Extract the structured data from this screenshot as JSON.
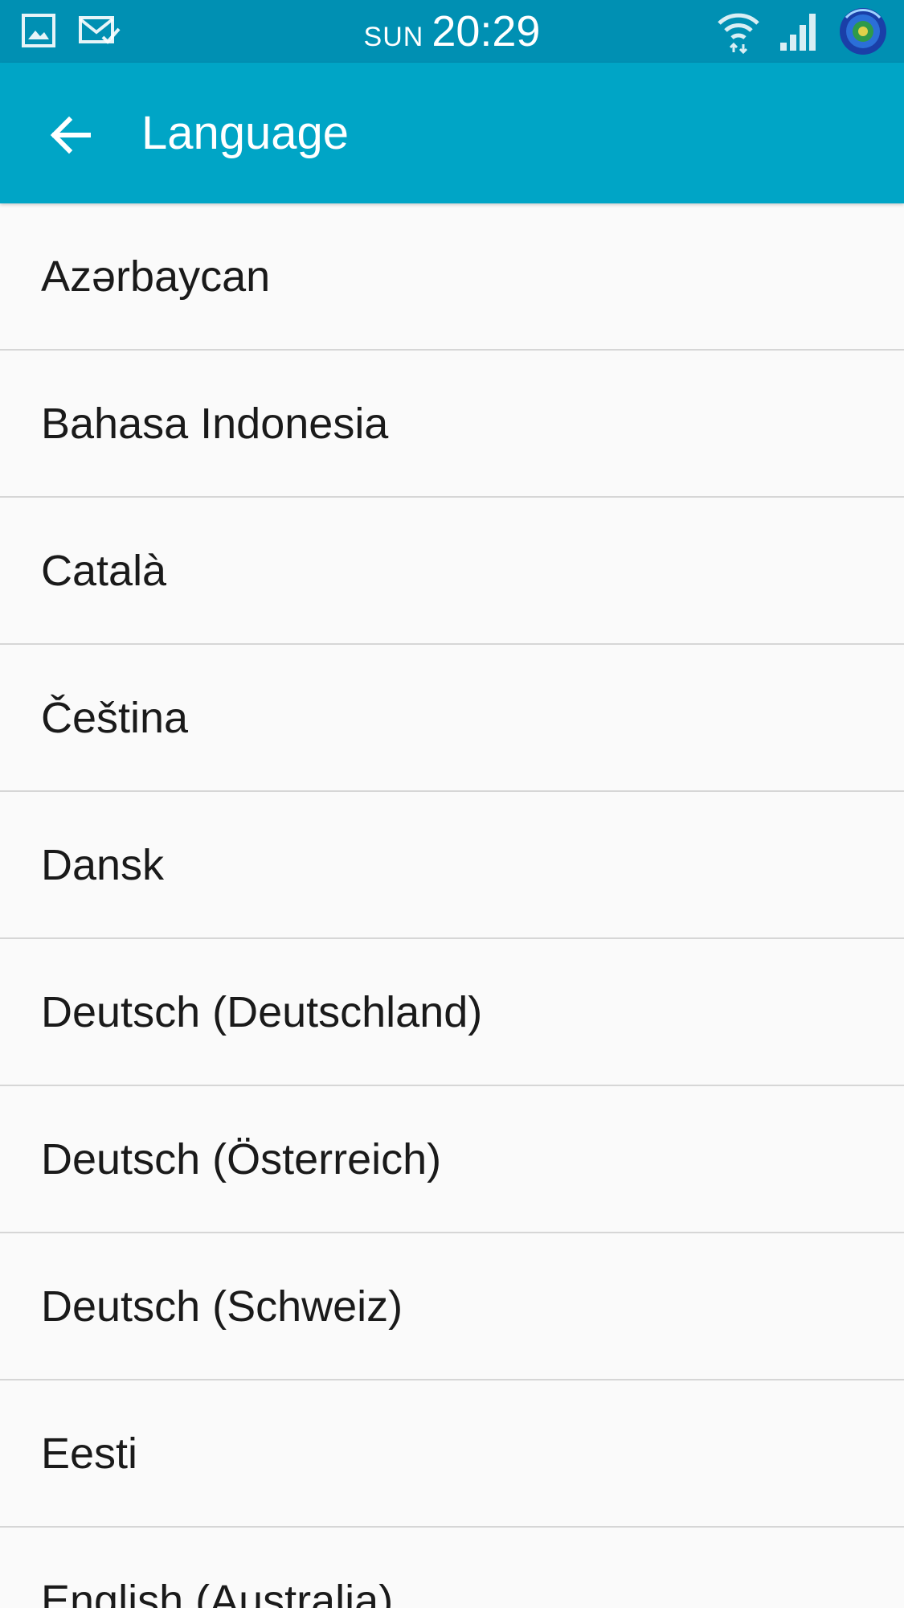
{
  "status_bar": {
    "day": "SUN",
    "time": "20:29",
    "left_icons": [
      "gallery-notification-icon",
      "mail-sent-icon"
    ],
    "right_icons": [
      "wifi-icon",
      "cell-signal-icon",
      "app-notification-icon"
    ]
  },
  "app_bar": {
    "title": "Language",
    "back_icon": "arrow-back-icon"
  },
  "languages": [
    "Azərbaycan",
    "Bahasa Indonesia",
    "Català",
    "Čeština",
    "Dansk",
    "Deutsch (Deutschland)",
    "Deutsch (Österreich)",
    "Deutsch (Schweiz)",
    "Eesti",
    "English (Australia)"
  ],
  "colors": {
    "status_bar": "#0090b3",
    "app_bar": "#00a5c6",
    "background": "#fafafa",
    "divider": "#d6d6d6"
  }
}
